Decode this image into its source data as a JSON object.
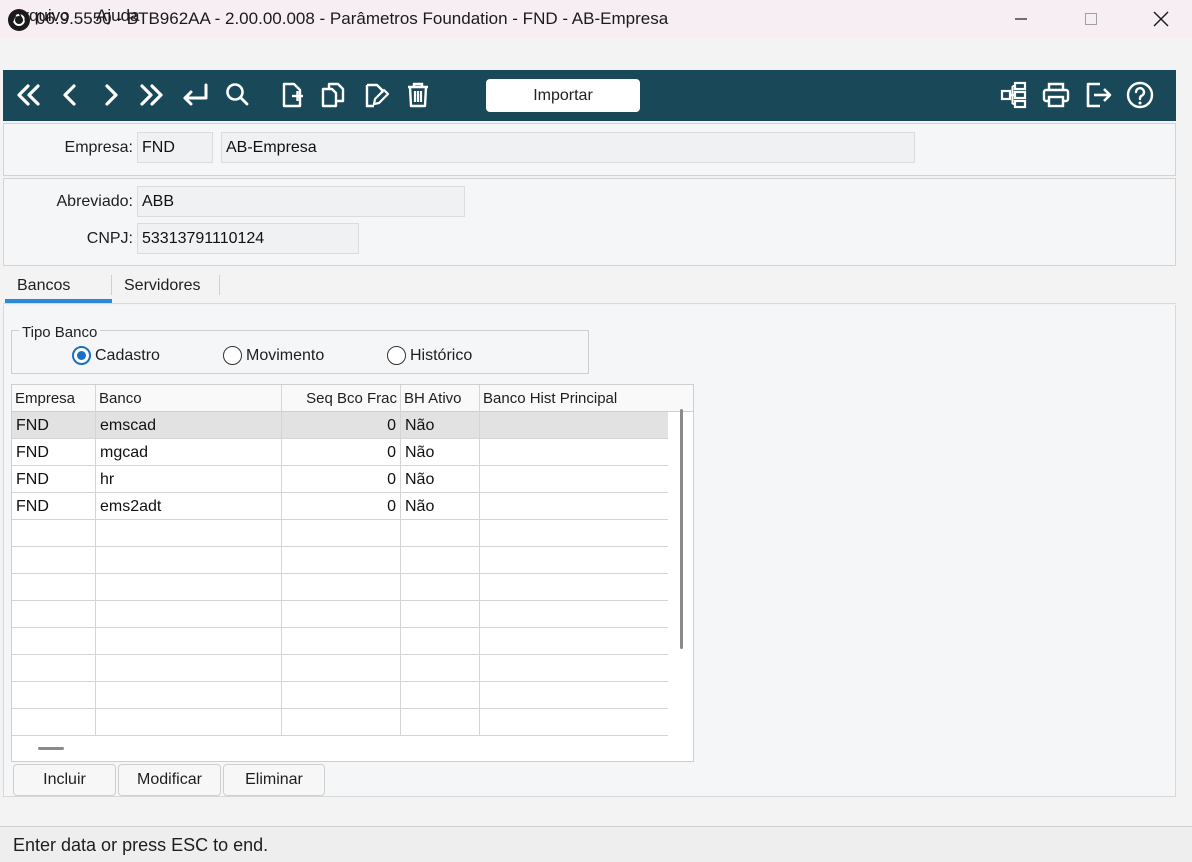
{
  "window": {
    "title": "06.9.5550 - BTB962AA - 2.00.00.008 - Parâmetros Foundation - FND - AB-Empresa"
  },
  "menu": {
    "items": [
      "Arquivo",
      "Ajuda"
    ]
  },
  "toolbar": {
    "importar_label": "Importar",
    "icons_left": [
      "first-record-icon",
      "previous-record-icon",
      "next-record-icon",
      "last-record-icon",
      "goto-icon",
      "search-icon",
      "new-record-icon",
      "copy-record-icon",
      "edit-record-icon",
      "delete-record-icon"
    ],
    "icons_right": [
      "hierarchy-icon",
      "print-icon",
      "exit-icon",
      "help-icon"
    ],
    "background_color": "#194858"
  },
  "header_form": {
    "empresa_label": "Empresa:",
    "empresa_code": "FND",
    "empresa_name": "AB-Empresa",
    "abreviado_label": "Abreviado:",
    "abreviado_value": "ABB",
    "cnpj_label": "CNPJ:",
    "cnpj_value": "53313791110124"
  },
  "tabs": {
    "items": [
      {
        "label": "Bancos",
        "active": true
      },
      {
        "label": "Servidores",
        "active": false
      }
    ]
  },
  "tipo_banco": {
    "title": "Tipo Banco",
    "options": [
      {
        "label": "Cadastro",
        "checked": true
      },
      {
        "label": "Movimento",
        "checked": false
      },
      {
        "label": "Histórico",
        "checked": false
      }
    ]
  },
  "grid": {
    "columns": [
      "Empresa",
      "Banco",
      "Seq Bco Frac",
      "BH Ativo",
      "Banco Hist Principal"
    ],
    "rows": [
      [
        "FND",
        "emscad",
        "0",
        "Não",
        ""
      ],
      [
        "FND",
        "mgcad",
        "0",
        "Não",
        ""
      ],
      [
        "FND",
        "hr",
        "0",
        "Não",
        ""
      ],
      [
        "FND",
        "ems2adt",
        "0",
        "Não",
        ""
      ]
    ],
    "selected_row": 0
  },
  "actions": {
    "incluir": "Incluir",
    "modificar": "Modificar",
    "eliminar": "Eliminar"
  },
  "status": {
    "text": "Enter data or press ESC to end."
  },
  "colors": {
    "accent": "#2a8ad6",
    "radio": "#1a6fc4"
  }
}
